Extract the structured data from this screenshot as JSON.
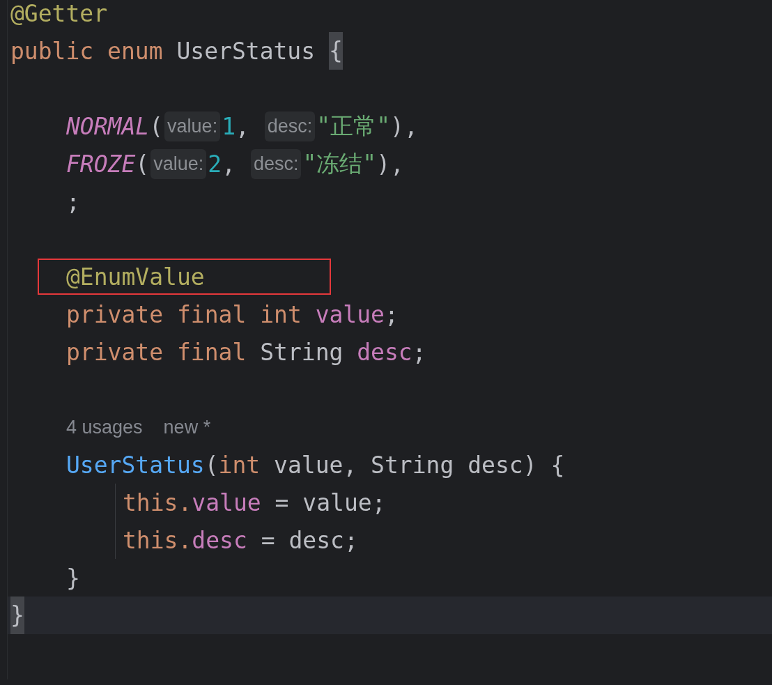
{
  "editor": {
    "lines": [
      {
        "kind": "code",
        "tokens": [
          {
            "kind": "annotation",
            "text": "@Getter"
          }
        ]
      },
      {
        "kind": "code",
        "tokens": [
          {
            "kind": "keyword",
            "text": "public "
          },
          {
            "kind": "keyword",
            "text": "enum "
          },
          {
            "kind": "plain",
            "text": "UserStatus "
          },
          {
            "kind": "plain",
            "text": "{",
            "matched": true
          }
        ],
        "children": [
          {
            "kind": "blank"
          },
          {
            "kind": "code",
            "tokens": [
              {
                "kind": "constant",
                "text": "NORMAL"
              },
              {
                "kind": "plain",
                "text": "("
              },
              {
                "kind": "hint",
                "text": "value:"
              },
              {
                "kind": "number",
                "text": "1"
              },
              {
                "kind": "plain",
                "text": ", "
              },
              {
                "kind": "hint",
                "text": "desc:"
              },
              {
                "kind": "string",
                "text": "\"正常\""
              },
              {
                "kind": "plain",
                "text": "),"
              }
            ]
          },
          {
            "kind": "code",
            "tokens": [
              {
                "kind": "constant",
                "text": "FROZE"
              },
              {
                "kind": "plain",
                "text": "("
              },
              {
                "kind": "hint",
                "text": "value:"
              },
              {
                "kind": "number",
                "text": "2"
              },
              {
                "kind": "plain",
                "text": ", "
              },
              {
                "kind": "hint",
                "text": "desc:"
              },
              {
                "kind": "string",
                "text": "\"冻结\""
              },
              {
                "kind": "plain",
                "text": "),"
              }
            ]
          },
          {
            "kind": "code",
            "tokens": [
              {
                "kind": "plain",
                "text": ";"
              }
            ]
          },
          {
            "kind": "blank"
          },
          {
            "kind": "code",
            "boxed": true,
            "tokens": [
              {
                "kind": "annotation",
                "text": "@EnumValue"
              }
            ]
          },
          {
            "kind": "code",
            "tokens": [
              {
                "kind": "keyword",
                "text": "private final int "
              },
              {
                "kind": "field",
                "text": "value"
              },
              {
                "kind": "plain",
                "text": ";"
              }
            ]
          },
          {
            "kind": "code",
            "tokens": [
              {
                "kind": "keyword",
                "text": "private final "
              },
              {
                "kind": "plain",
                "text": "String "
              },
              {
                "kind": "field",
                "text": "desc"
              },
              {
                "kind": "plain",
                "text": ";"
              }
            ]
          },
          {
            "kind": "blank"
          },
          {
            "kind": "lens",
            "tokens": [
              {
                "kind": "lens",
                "text": "4 usages"
              },
              {
                "kind": "lens",
                "text": "new *"
              }
            ]
          },
          {
            "kind": "code",
            "indent_guide": true,
            "tokens": [
              {
                "kind": "function",
                "text": "UserStatus"
              },
              {
                "kind": "plain",
                "text": "("
              },
              {
                "kind": "keyword",
                "text": "int "
              },
              {
                "kind": "plain",
                "text": "value, String desc) {"
              }
            ],
            "children": [
              {
                "kind": "code",
                "tokens": [
                  {
                    "kind": "keyword",
                    "text": "this."
                  },
                  {
                    "kind": "field",
                    "text": "value"
                  },
                  {
                    "kind": "plain",
                    "text": " = value;"
                  }
                ]
              },
              {
                "kind": "code",
                "tokens": [
                  {
                    "kind": "keyword",
                    "text": "this."
                  },
                  {
                    "kind": "field",
                    "text": "desc"
                  },
                  {
                    "kind": "plain",
                    "text": " = desc;"
                  }
                ]
              }
            ]
          },
          {
            "kind": "code",
            "tokens": [
              {
                "kind": "plain",
                "text": "}"
              }
            ]
          }
        ]
      },
      {
        "kind": "code",
        "current": true,
        "tokens": [
          {
            "kind": "plain",
            "text": "}",
            "matched": true
          }
        ]
      }
    ]
  }
}
